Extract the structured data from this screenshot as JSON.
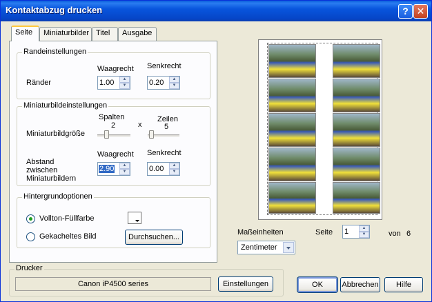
{
  "window": {
    "title": "Kontaktabzug drucken",
    "help_label": "?",
    "close_label": "✕"
  },
  "tabs": [
    {
      "label": "Seite",
      "active": true
    },
    {
      "label": "Miniaturbilder",
      "active": false
    },
    {
      "label": "Titel",
      "active": false
    },
    {
      "label": "Ausgabe",
      "active": false
    }
  ],
  "margins": {
    "group_label": "Randeinstellungen",
    "horizontal_header": "Waagrecht",
    "vertical_header": "Senkrecht",
    "row_label": "Ränder",
    "horizontal_value": "1.00",
    "vertical_value": "0.20"
  },
  "thumbnails": {
    "group_label": "Miniaturbildeinstellungen",
    "columns_label": "Spalten",
    "columns_value": "2",
    "times": "x",
    "rows_label": "Zeilen",
    "rows_value": "5",
    "size_label": "Miniaturbildgröße",
    "columns_slider": 0.25,
    "rows_slider": 0.05,
    "spacing_horizontal_header": "Waagrecht",
    "spacing_vertical_header": "Senkrecht",
    "spacing_label_1": "Abstand",
    "spacing_label_2": "zwischen",
    "spacing_label_3": "Miniaturbildern",
    "spacing_horizontal_value": "2.90",
    "spacing_vertical_value": "0.00"
  },
  "background": {
    "group_label": "Hintergrundoptionen",
    "solid_label": "Vollton-Füllfarbe",
    "tiled_label": "Gekacheltes Bild",
    "browse_label": "Durchsuchen...",
    "selected": "solid"
  },
  "printer": {
    "group_label": "Drucker",
    "name": "Canon iP4500 series",
    "settings_label": "Einstellungen"
  },
  "preview": {
    "units_label": "Maßeinheiten",
    "units_value": "Zentimeter",
    "page_label": "Seite",
    "page_value": "1",
    "of_label": "von",
    "page_total": "6"
  },
  "actions": {
    "ok_label": "OK",
    "cancel_label": "Abbrechen",
    "help_label": "Hilfe"
  },
  "colors": {
    "title_bar": "#0855dd",
    "dialog_bg": "#ece9d8",
    "selection": "#316ac5"
  }
}
